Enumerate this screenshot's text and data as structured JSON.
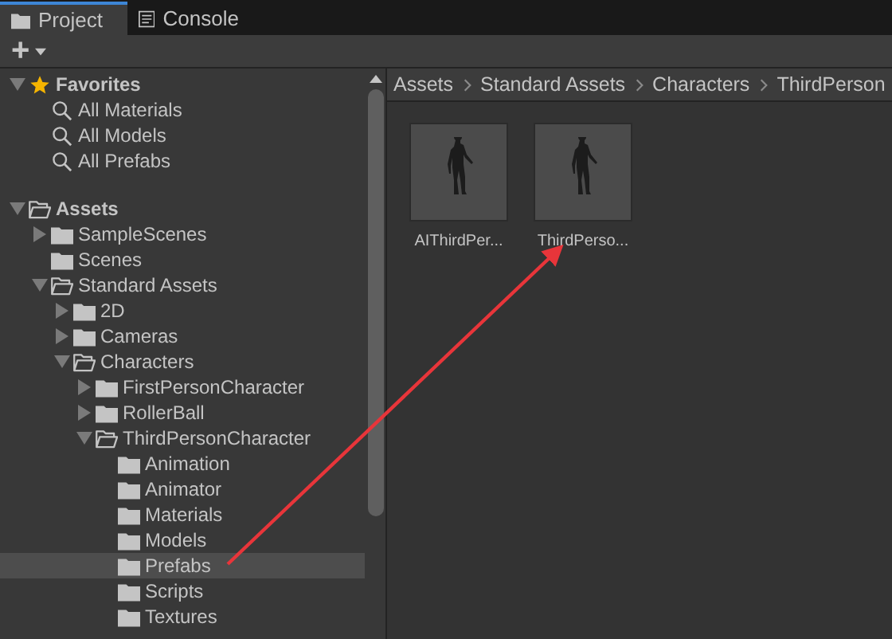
{
  "tabs": [
    {
      "label": "Project",
      "kind": "folder",
      "selected": true
    },
    {
      "label": "Console",
      "kind": "console",
      "selected": false
    }
  ],
  "toolbar": {
    "add_button": "+"
  },
  "tree": [
    {
      "label": "Favorites",
      "kind": "favorites",
      "expanded": true,
      "selected": false,
      "children": [
        {
          "label": "All Materials",
          "kind": "search",
          "selected": false
        },
        {
          "label": "All Models",
          "kind": "search",
          "selected": false
        },
        {
          "label": "All Prefabs",
          "kind": "search",
          "selected": false
        }
      ]
    },
    {
      "label": "Assets",
      "kind": "folder",
      "expanded": true,
      "selected": false,
      "children": [
        {
          "label": "SampleScenes",
          "kind": "folder",
          "expanded": false,
          "selected": false
        },
        {
          "label": "Scenes",
          "kind": "folder",
          "selected": false
        },
        {
          "label": "Standard Assets",
          "kind": "folder",
          "expanded": true,
          "selected": false,
          "children": [
            {
              "label": "2D",
              "kind": "folder",
              "expanded": false,
              "selected": false
            },
            {
              "label": "Cameras",
              "kind": "folder",
              "expanded": false,
              "selected": false
            },
            {
              "label": "Characters",
              "kind": "folder",
              "expanded": true,
              "selected": false,
              "children": [
                {
                  "label": "FirstPersonCharacter",
                  "kind": "folder",
                  "expanded": false,
                  "selected": false
                },
                {
                  "label": "RollerBall",
                  "kind": "folder",
                  "expanded": false,
                  "selected": false
                },
                {
                  "label": "ThirdPersonCharacter",
                  "kind": "folder",
                  "expanded": true,
                  "selected": false,
                  "children": [
                    {
                      "label": "Animation",
                      "kind": "folder",
                      "selected": false
                    },
                    {
                      "label": "Animator",
                      "kind": "folder",
                      "selected": false
                    },
                    {
                      "label": "Materials",
                      "kind": "folder",
                      "selected": false
                    },
                    {
                      "label": "Models",
                      "kind": "folder",
                      "selected": false
                    },
                    {
                      "label": "Prefabs",
                      "kind": "folder",
                      "selected": true
                    },
                    {
                      "label": "Scripts",
                      "kind": "folder",
                      "selected": false
                    },
                    {
                      "label": "Textures",
                      "kind": "folder",
                      "selected": false
                    }
                  ]
                }
              ]
            }
          ]
        }
      ]
    }
  ],
  "breadcrumb": [
    "Assets",
    "Standard Assets",
    "Characters",
    "ThirdPerson"
  ],
  "assets": [
    {
      "label": "AIThirdPer...",
      "selected": false
    },
    {
      "label": "ThirdPerso...",
      "selected": false
    }
  ]
}
